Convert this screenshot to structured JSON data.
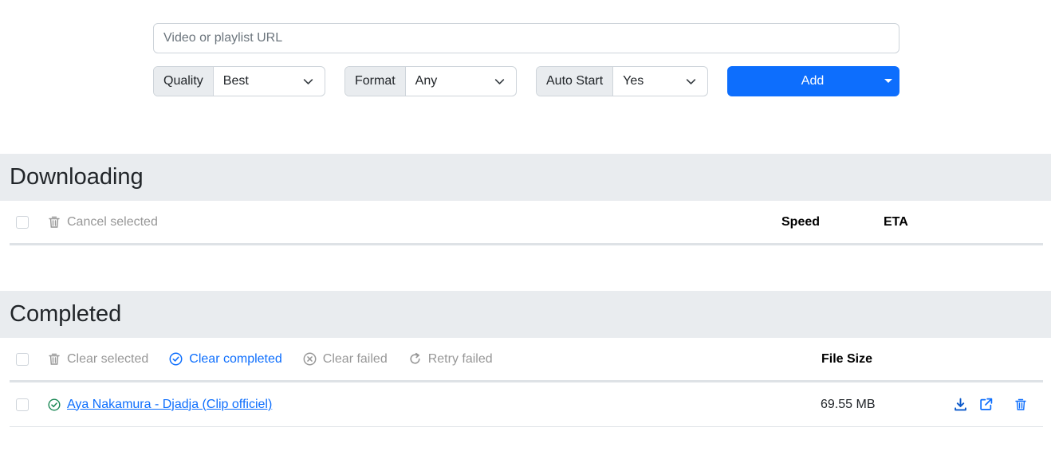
{
  "form": {
    "url_placeholder": "Video or playlist URL",
    "url_value": "",
    "quality": {
      "label": "Quality",
      "value": "Best"
    },
    "format": {
      "label": "Format",
      "value": "Any"
    },
    "auto_start": {
      "label": "Auto Start",
      "value": "Yes"
    },
    "add_label": "Add"
  },
  "downloading": {
    "title": "Downloading",
    "cancel_selected": "Cancel selected",
    "col_speed": "Speed",
    "col_eta": "ETA"
  },
  "completed": {
    "title": "Completed",
    "clear_selected": "Clear selected",
    "clear_completed": "Clear completed",
    "clear_failed": "Clear failed",
    "retry_failed": "Retry failed",
    "col_file_size": "File Size",
    "items": [
      {
        "title": "Aya Nakamura - Djadja (Clip officiel)",
        "file_size": "69.55 MB",
        "status": "success"
      }
    ]
  },
  "colors": {
    "primary": "#0d6efd",
    "success": "#198754",
    "muted": "#979797",
    "header_bg": "#e9ecef"
  },
  "icons": [
    "chevron-down-icon",
    "caret-down-icon",
    "trash-icon",
    "check-circle-icon",
    "x-circle-icon",
    "retry-icon",
    "download-icon",
    "open-external-icon"
  ]
}
